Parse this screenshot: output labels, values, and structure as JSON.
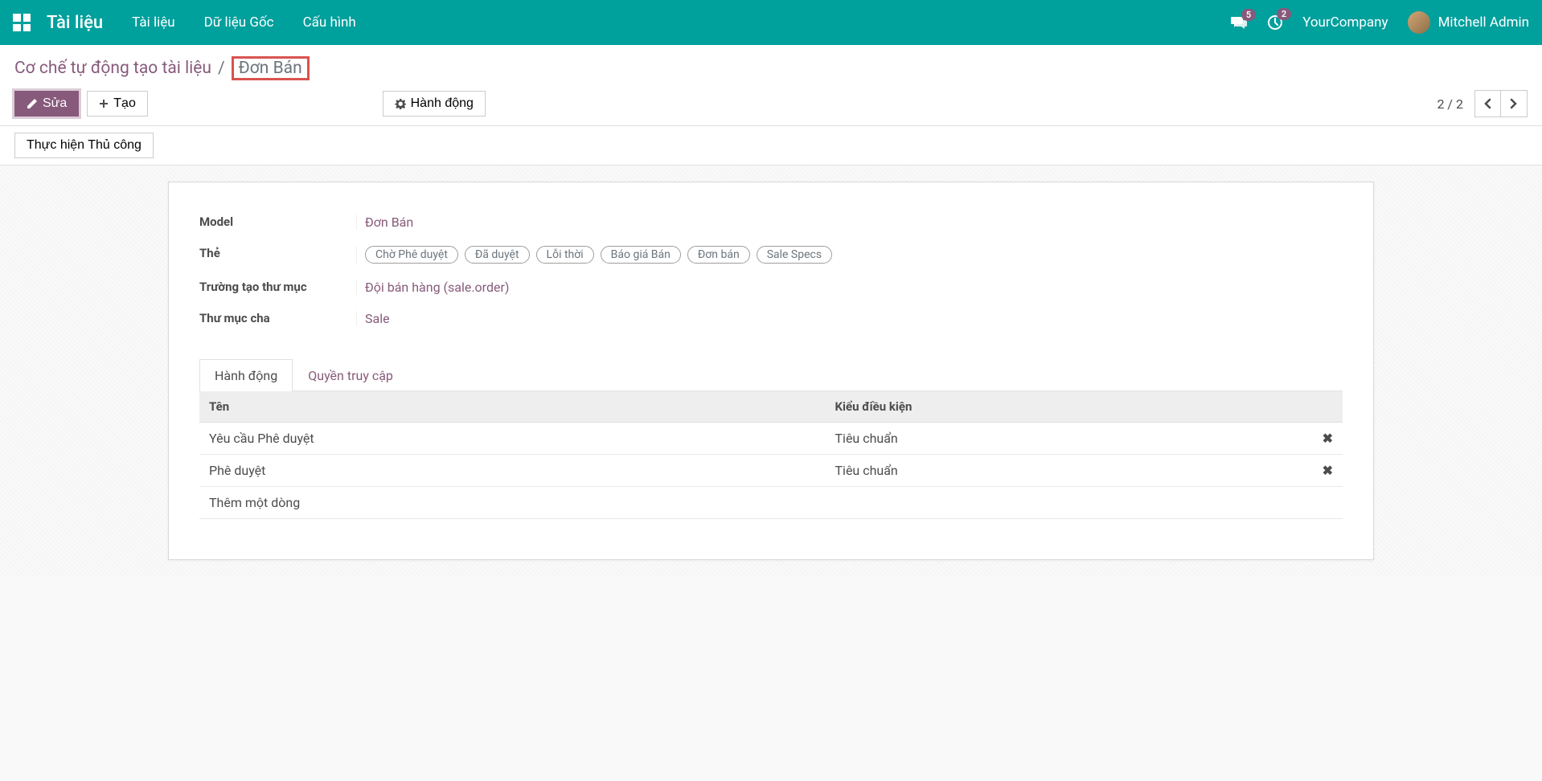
{
  "topbar": {
    "app_title": "Tài liệu",
    "menu": [
      "Tài liệu",
      "Dữ liệu Gốc",
      "Cấu hình"
    ],
    "messages_badge": "5",
    "activities_badge": "2",
    "company": "YourCompany",
    "user": "Mitchell Admin"
  },
  "breadcrumb": {
    "parent": "Cơ chế tự động tạo tài liệu",
    "current": "Đơn Bán"
  },
  "buttons": {
    "edit": "Sửa",
    "create": "Tạo",
    "action": "Hành động"
  },
  "pager": {
    "value": "2 / 2"
  },
  "statusbar": {
    "manual": "Thực hiện Thủ công"
  },
  "form": {
    "labels": {
      "model": "Model",
      "tags": "Thẻ",
      "folder_field": "Trường tạo thư mục",
      "parent_folder": "Thư mục cha"
    },
    "values": {
      "model": "Đơn Bán",
      "folder_field": "Đội bán hàng (sale.order)",
      "parent_folder": "Sale"
    },
    "tags": [
      "Chờ Phê duyệt",
      "Đã duyệt",
      "Lỗi thời",
      "Báo giá Bán",
      "Đơn bán",
      "Sale Specs"
    ]
  },
  "tabs": {
    "action": "Hành động",
    "access": "Quyền truy cập"
  },
  "table": {
    "headers": {
      "name": "Tên",
      "condition": "Kiểu điều kiện"
    },
    "rows": [
      {
        "name": "Yêu cầu Phê duyệt",
        "condition": "Tiêu chuẩn"
      },
      {
        "name": "Phê duyệt",
        "condition": "Tiêu chuẩn"
      }
    ],
    "add_line": "Thêm một dòng"
  }
}
